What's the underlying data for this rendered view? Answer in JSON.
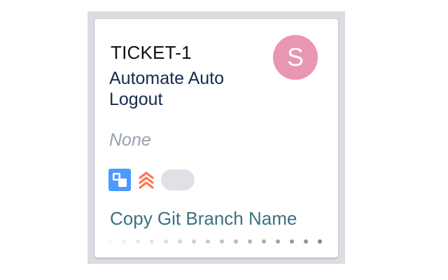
{
  "card": {
    "ticket_key": "TICKET-1",
    "summary": "Automate Auto Logout",
    "assignee_initial": "S",
    "epic": "None",
    "copy_branch_label": "Copy Git Branch Name",
    "issue_type_icon": "subtask-icon",
    "priority_icon": "highest-priority-icon",
    "estimate_icon": "empty-estimate-badge",
    "colors": {
      "avatar": "#e896b1",
      "type_icon": "#4c9aff",
      "priority": "#ff7452",
      "link": "#3a7282",
      "epic_text": "#97a0af"
    }
  }
}
